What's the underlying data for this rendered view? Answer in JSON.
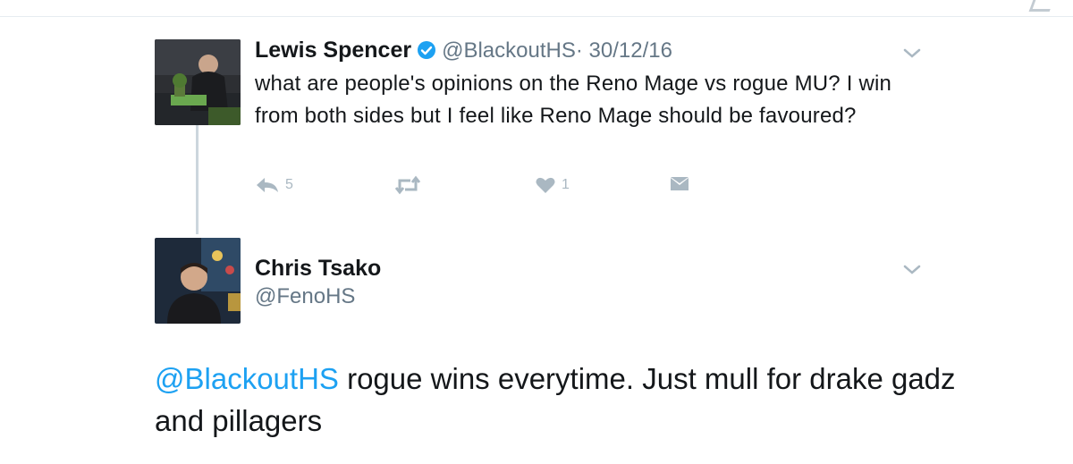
{
  "tweet1": {
    "display_name": "Lewis Spencer",
    "handle": "@BlackoutHS",
    "date": "· 30/12/16",
    "text": "what are people's opinions on the Reno Mage vs rogue MU? I win from both sides but I feel like Reno Mage should be favoured?",
    "verified": true,
    "actions": {
      "reply_icon": "reply-icon",
      "reply_count": "5",
      "retweet_icon": "retweet-icon",
      "retweet_count": "",
      "like_icon": "heart-icon",
      "like_count": "1",
      "dm_icon": "envelope-icon"
    }
  },
  "tweet2": {
    "display_name": "Chris Tsako",
    "handle": "@FenoHS",
    "mention": "@BlackoutHS",
    "text": " rogue wins everytime. Just mull for drake gadz and pillagers"
  },
  "colors": {
    "link": "#1da1f2",
    "secondary": "#657786",
    "action": "#aab8c2",
    "verified": "#1da1f2",
    "thread_line": "#ccd6dd"
  }
}
